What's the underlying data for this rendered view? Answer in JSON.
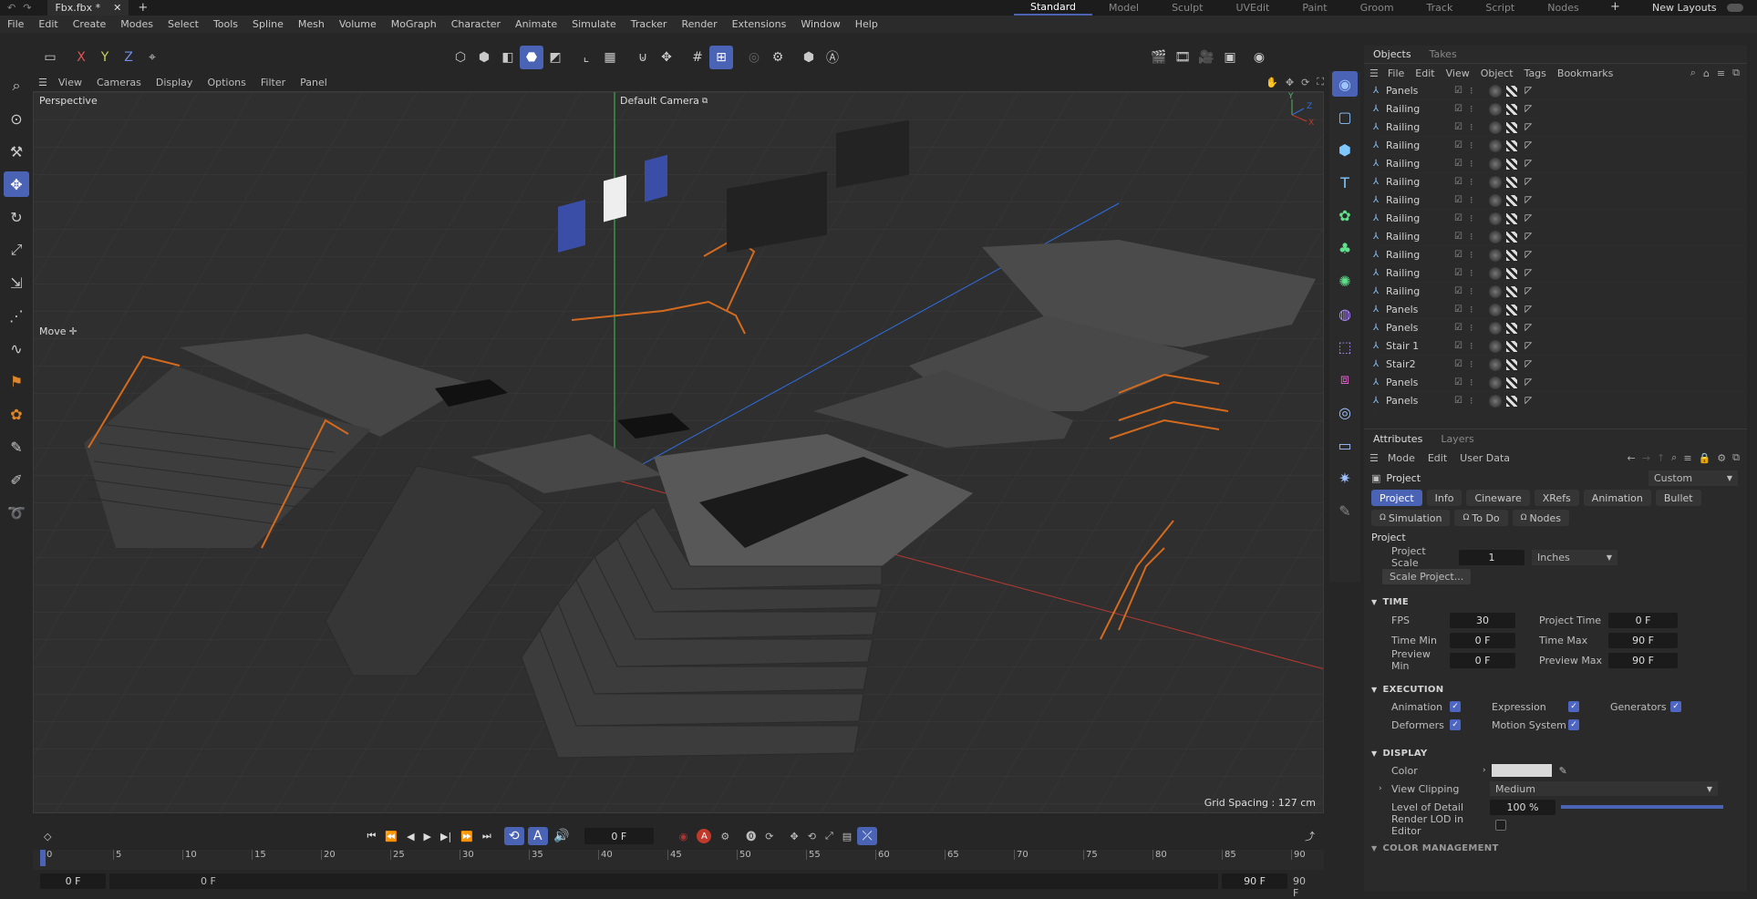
{
  "titlebar": {
    "tab_title": "Fbx.fbx *",
    "layouts": [
      "Standard",
      "Model",
      "Sculpt",
      "UVEdit",
      "Paint",
      "Groom",
      "Track",
      "Script",
      "Nodes"
    ],
    "active_layout": "Standard",
    "new_layouts": "New Layouts"
  },
  "menu": [
    "File",
    "Edit",
    "Create",
    "Modes",
    "Select",
    "Tools",
    "Spline",
    "Mesh",
    "Volume",
    "MoGraph",
    "Character",
    "Animate",
    "Simulate",
    "Tracker",
    "Render",
    "Extensions",
    "Window",
    "Help"
  ],
  "viewport": {
    "menu": [
      "View",
      "Cameras",
      "Display",
      "Options",
      "Filter",
      "Panel"
    ],
    "name": "Perspective",
    "camera": "Default Camera",
    "tool_label": "Move",
    "grid_spacing": "Grid Spacing : 127 cm"
  },
  "objects_panel": {
    "tabs": [
      "Objects",
      "Takes"
    ],
    "menu": [
      "File",
      "Edit",
      "View",
      "Object",
      "Tags",
      "Bookmarks"
    ],
    "items": [
      "Panels",
      "Railing",
      "Railing",
      "Railing",
      "Railing",
      "Railing",
      "Railing",
      "Railing",
      "Railing",
      "Railing",
      "Railing",
      "Railing",
      "Panels",
      "Panels",
      "Stair 1",
      "Stair2",
      "Panels",
      "Panels"
    ]
  },
  "attributes": {
    "tabs": [
      "Attributes",
      "Layers"
    ],
    "menu": [
      "Mode",
      "Edit",
      "User Data"
    ],
    "object_name": "Project",
    "preset": "Custom",
    "tab_row1": [
      "Project",
      "Info",
      "Cineware",
      "XRefs",
      "Animation",
      "Bullet"
    ],
    "tab_row2": [
      "Simulation",
      "To Do",
      "Nodes"
    ],
    "active_tab": "Project",
    "section_project": "Project",
    "project_scale_label": "Project Scale",
    "project_scale_value": "1",
    "project_scale_unit": "Inches",
    "scale_project_button": "Scale Project...",
    "time_section": "TIME",
    "fps_label": "FPS",
    "fps": "30",
    "project_time_label": "Project Time",
    "project_time": "0 F",
    "time_min_label": "Time Min",
    "time_min": "0 F",
    "time_max_label": "Time Max",
    "time_max": "90 F",
    "preview_min_label": "Preview Min",
    "preview_min": "0 F",
    "preview_max_label": "Preview Max",
    "preview_max": "90 F",
    "execution_section": "EXECUTION",
    "animation_label": "Animation",
    "expression_label": "Expression",
    "generators_label": "Generators",
    "deformers_label": "Deformers",
    "motion_system_label": "Motion System",
    "display_section": "DISPLAY",
    "color_label": "Color",
    "color_value": "#d9d9d9",
    "view_clipping_label": "View Clipping",
    "view_clipping": "Medium",
    "lod_label": "Level of Detail",
    "lod": "100 %",
    "lod_fraction": 1.0,
    "render_lod_label": "Render LOD in Editor",
    "color_mgmt_section": "COLOR MANAGEMENT"
  },
  "timeline": {
    "current_frame": "0 F",
    "ticks": [
      "0",
      "5",
      "10",
      "15",
      "20",
      "25",
      "30",
      "35",
      "40",
      "45",
      "50",
      "55",
      "60",
      "65",
      "70",
      "75",
      "80",
      "85",
      "90"
    ],
    "start": "0 F",
    "start2": "0 F",
    "end": "90 F",
    "end2": "90 F"
  },
  "colors": {
    "accent": "#4a63b5",
    "axis_red": "#c0392b",
    "axis_green": "#2ecc71",
    "axis_blue": "#2f6fe0",
    "railing": "#d46a1e"
  }
}
